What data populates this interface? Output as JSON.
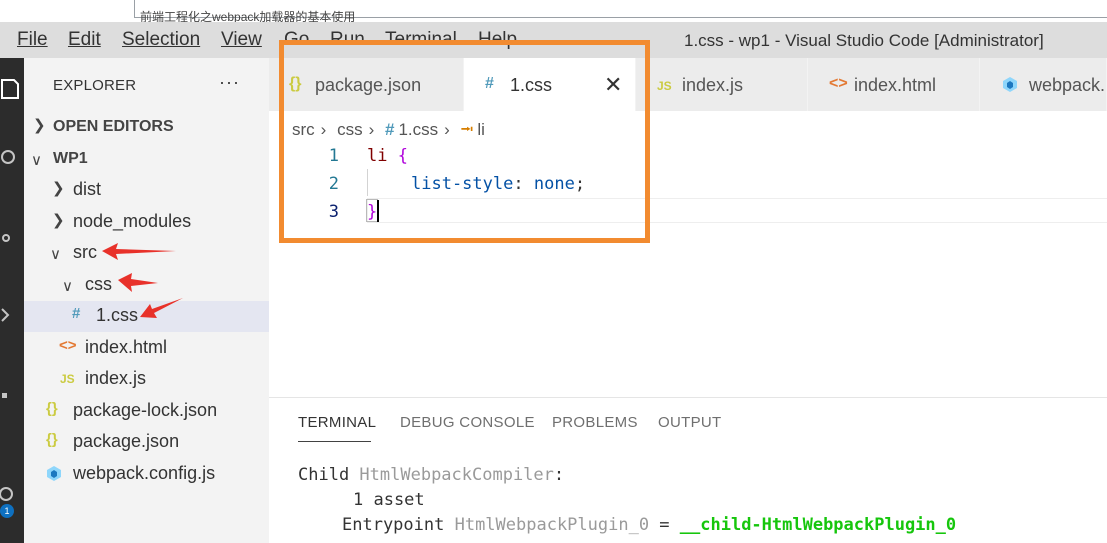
{
  "browser": {
    "partial_text": "前端工程化之webpack加载器的基本使用"
  },
  "menu": [
    "File",
    "Edit",
    "Selection",
    "View",
    "Go",
    "Run",
    "Terminal",
    "Help"
  ],
  "window_title": "1.css - wp1 - Visual Studio Code [Administrator]",
  "activity_badge": "1",
  "explorer": {
    "header": "EXPLORER",
    "more": "···",
    "open_editors": "OPEN EDITORS",
    "project": "WP1",
    "items": [
      "dist",
      "node_modules",
      "src",
      "css",
      "1.css",
      "index.html",
      "index.js",
      "package-lock.json",
      "package.json",
      "webpack.config.js"
    ]
  },
  "tabs": [
    {
      "label": "package.json",
      "icon": "{}"
    },
    {
      "label": "1.css",
      "icon": "#"
    },
    {
      "label": "index.js",
      "icon": "JS"
    },
    {
      "label": "index.html",
      "icon": "<>"
    },
    {
      "label": "webpack.",
      "icon": "cube"
    }
  ],
  "breadcrumb": [
    "src",
    "css",
    "1.css",
    "li"
  ],
  "code": {
    "line_numbers": [
      "1",
      "2",
      "3"
    ],
    "line1_selector": "li",
    "line1_brace": "{",
    "line2_prop": "list-style",
    "line2_colon": ":",
    "line2_value": "none",
    "line2_semi": ";",
    "line3_brace": "}"
  },
  "panel": {
    "tabs": [
      "TERMINAL",
      "DEBUG CONSOLE",
      "PROBLEMS",
      "OUTPUT"
    ],
    "line1_a": "Child ",
    "line1_b": "HtmlWebpackCompiler",
    "line1_c": ":",
    "line2": "1 asset",
    "line3_a": "Entrypoint ",
    "line3_b": "HtmlWebpackPlugin_0",
    "line3_c": " = ",
    "line3_d": "__child-HtmlWebpackPlugin_0"
  },
  "colors": {
    "annotation_box": "#f28b30",
    "annotation_arrow": "#e8312a"
  }
}
